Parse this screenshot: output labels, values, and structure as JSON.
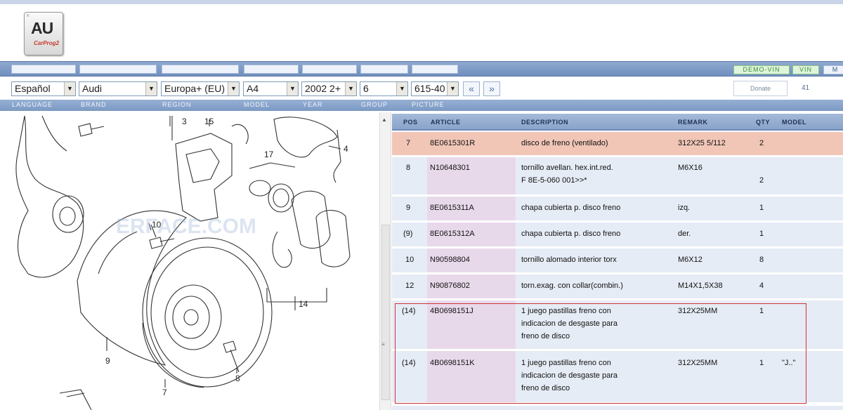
{
  "logo": {
    "main": "AU",
    "sub": "CarProg2",
    "mark": "R"
  },
  "toolbar": {
    "demo_vin": "DEMO-VIN",
    "vin": "VIN",
    "more": "M"
  },
  "selectors": {
    "language": "Español",
    "brand": "Audi",
    "region": "Europa+ (EU)",
    "model": "A4",
    "year": "2002  2+",
    "group": "6",
    "picture": "615-40"
  },
  "nav": {
    "prev": "«",
    "next": "»"
  },
  "donate": "Donate",
  "count": "41",
  "labels": {
    "language": "LANGUAGE",
    "brand": "BRAND",
    "region": "REGION",
    "model": "MODEL",
    "year": "YEAR",
    "group": "GROUP",
    "picture": "PICTURE"
  },
  "diagram": {
    "watermark": "ERFACE.COM",
    "callouts": [
      "3",
      "15",
      "4",
      "17",
      "10",
      "14",
      "9",
      "7",
      "8"
    ]
  },
  "table": {
    "columns": {
      "pos": "POS",
      "article": "ARTICLE",
      "description": "DESCRIPTION",
      "remark": "REMARK",
      "qty": "QTY",
      "model": "MODEL"
    },
    "rows": [
      {
        "pos": "7",
        "article": "8E0615301R",
        "description": "disco de freno (ventilado)",
        "remark": "312X25   5/112",
        "qty": "2",
        "model": ""
      },
      {
        "pos": "8",
        "article": "N10648301",
        "description": "tornillo avellan. hex.int.red.\nF 8E-5-060 001>>*",
        "remark": "M6X16",
        "qty": "2",
        "model": ""
      },
      {
        "pos": "9",
        "article": "8E0615311A",
        "description": "chapa cubierta p. disco freno",
        "remark": "izq.",
        "qty": "1",
        "model": ""
      },
      {
        "pos": "(9)",
        "article": "8E0615312A",
        "description": "chapa cubierta p. disco freno",
        "remark": "der.",
        "qty": "1",
        "model": ""
      },
      {
        "pos": "10",
        "article": "N90598804",
        "description": "tornillo alomado interior torx",
        "remark": "M6X12",
        "qty": "8",
        "model": ""
      },
      {
        "pos": "12",
        "article": "N90876802",
        "description": "torn.exag. con collar(combin.)",
        "remark": "M14X1,5X38",
        "qty": "4",
        "model": ""
      },
      {
        "pos": "(14)",
        "article": "4B0698151J",
        "description": "1 juego pastillas freno con\nindicacion de desgaste para\nfreno de disco",
        "remark": "312X25MM",
        "qty": "1",
        "model": ""
      },
      {
        "pos": "(14)",
        "article": "4B0698151K",
        "description": "1 juego pastillas freno con\nindicacion de desgaste para\nfreno de disco",
        "remark": "312X25MM",
        "qty": "1",
        "model": "\"J..\""
      }
    ]
  }
}
